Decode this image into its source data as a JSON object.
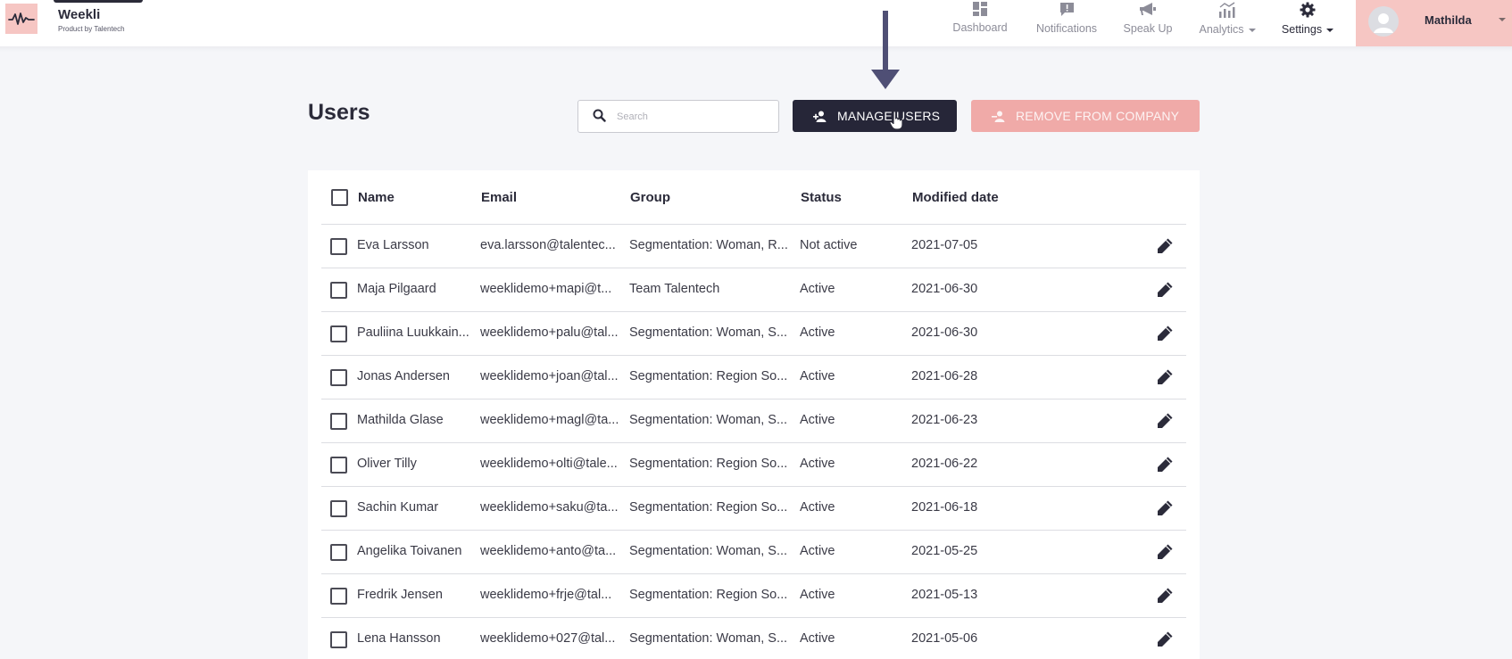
{
  "brand": {
    "name": "Weekli",
    "subtitle": "Product by Talentech"
  },
  "nav": [
    {
      "label": "Dashboard",
      "icon": "dashboard-icon"
    },
    {
      "label": "Notifications",
      "icon": "notification-icon"
    },
    {
      "label": "Speak Up",
      "icon": "megaphone-icon"
    },
    {
      "label": "Analytics",
      "icon": "analytics-icon",
      "dropdown": true
    },
    {
      "label": "Settings",
      "icon": "gear-icon",
      "dropdown": true
    }
  ],
  "user": {
    "name": "Mathilda"
  },
  "page": {
    "title": "Users"
  },
  "search": {
    "placeholder": "Search",
    "value": ""
  },
  "toolbar": {
    "manage_label": "MANAGE USERS",
    "remove_label": "REMOVE FROM COMPANY"
  },
  "table": {
    "columns": [
      "Name",
      "Email",
      "Group",
      "Status",
      "Modified date"
    ],
    "rows": [
      {
        "name": "Eva Larsson",
        "email": "eva.larsson@talentec...",
        "group": "Segmentation: Woman, R...",
        "status": "Not active",
        "modified": "2021-07-05"
      },
      {
        "name": "Maja Pilgaard",
        "email": "weeklidemo+mapi@t...",
        "group": "Team Talentech",
        "status": "Active",
        "modified": "2021-06-30"
      },
      {
        "name": "Pauliina Luukkain...",
        "email": "weeklidemo+palu@tal...",
        "group": "Segmentation: Woman, S...",
        "status": "Active",
        "modified": "2021-06-30"
      },
      {
        "name": "Jonas Andersen",
        "email": "weeklidemo+joan@tal...",
        "group": "Segmentation: Region So...",
        "status": "Active",
        "modified": "2021-06-28"
      },
      {
        "name": "Mathilda Glase",
        "email": "weeklidemo+magl@ta...",
        "group": "Segmentation: Woman, S...",
        "status": "Active",
        "modified": "2021-06-23"
      },
      {
        "name": "Oliver Tilly",
        "email": "weeklidemo+olti@tale...",
        "group": "Segmentation: Region So...",
        "status": "Active",
        "modified": "2021-06-22"
      },
      {
        "name": "Sachin Kumar",
        "email": "weeklidemo+saku@ta...",
        "group": "Segmentation: Region So...",
        "status": "Active",
        "modified": "2021-06-18"
      },
      {
        "name": "Angelika Toivanen",
        "email": "weeklidemo+anto@ta...",
        "group": "Segmentation: Woman, S...",
        "status": "Active",
        "modified": "2021-05-25"
      },
      {
        "name": "Fredrik Jensen",
        "email": "weeklidemo+frje@tal...",
        "group": "Segmentation: Region So...",
        "status": "Active",
        "modified": "2021-05-13"
      },
      {
        "name": "Lena Hansson",
        "email": "weeklidemo+027@tal...",
        "group": "Segmentation: Woman, S...",
        "status": "Active",
        "modified": "2021-05-06"
      }
    ]
  },
  "colors": {
    "brand_pink": "#f6c6c3",
    "primary_dark": "#262638",
    "danger_light": "#f0aaa8",
    "annotation_arrow": "#4f4f75"
  }
}
